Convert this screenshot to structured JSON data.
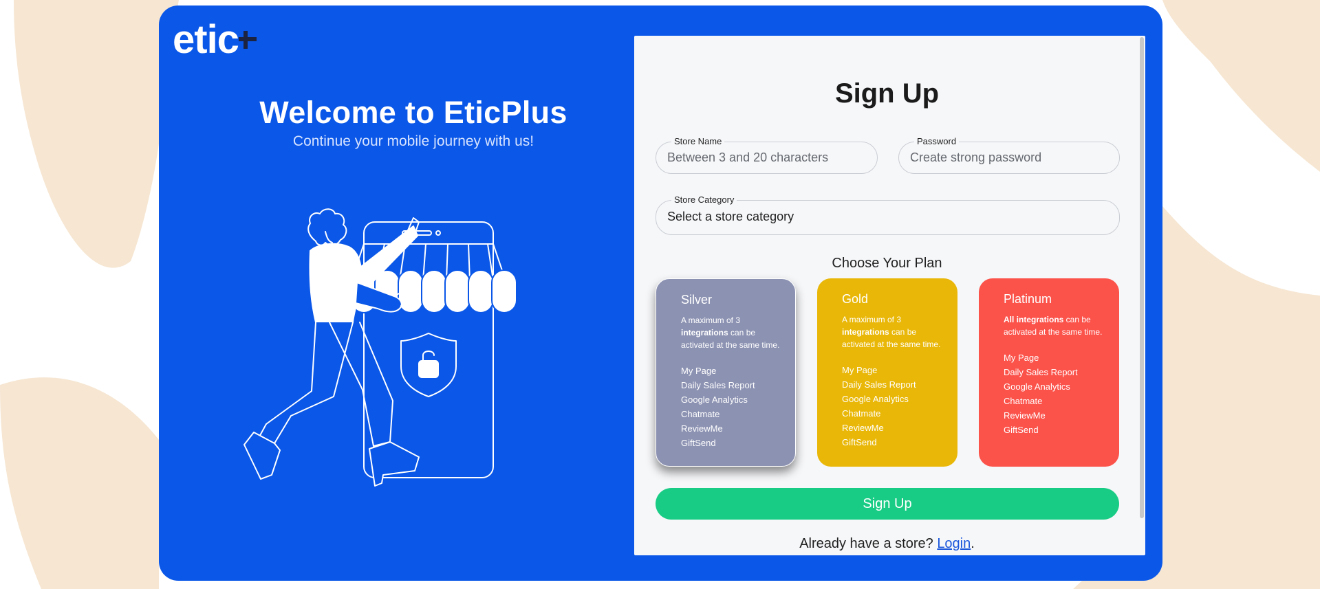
{
  "colors": {
    "background_blob": "#f6e6d2",
    "frame": "#0a57e8",
    "panel": "#f6f7f9",
    "signup_button": "#19cc85",
    "silver": "#8c92b2",
    "gold": "#e9b707",
    "platinum": "#fb524a",
    "link": "#1a56db"
  },
  "logo": {
    "text": "etic",
    "icon": "plus-icon"
  },
  "hero": {
    "title": "Welcome to EticPlus",
    "subtitle": "Continue your mobile journey with us!",
    "illustration": "person-pointing-at-phone-store-illustration"
  },
  "form": {
    "title": "Sign Up",
    "store_name": {
      "label": "Store Name",
      "placeholder": "Between 3 and 20 characters",
      "value": ""
    },
    "password": {
      "label": "Password",
      "placeholder": "Create strong password",
      "value": ""
    },
    "store_category": {
      "label": "Store Category",
      "selected": "Select a store category"
    },
    "plan_heading": "Choose Your Plan",
    "plans": [
      {
        "name": "Silver",
        "desc_prefix": "A maximum of 3 ",
        "desc_bold": "integrations",
        "desc_suffix": " can be activated at the same time.",
        "features": [
          "My Page",
          "Daily Sales Report",
          "Google Analytics",
          "Chatmate",
          "ReviewMe",
          "GiftSend"
        ],
        "selected": true
      },
      {
        "name": "Gold",
        "desc_prefix": "A maximum of 3 ",
        "desc_bold": "integrations",
        "desc_suffix": " can be activated at the same time.",
        "features": [
          "My Page",
          "Daily Sales Report",
          "Google Analytics",
          "Chatmate",
          "ReviewMe",
          "GiftSend"
        ],
        "selected": false
      },
      {
        "name": "Platinum",
        "desc_prefix": "",
        "desc_bold": "All integrations",
        "desc_suffix": " can be activated at the same time.",
        "features": [
          "My Page",
          "Daily Sales Report",
          "Google Analytics",
          "Chatmate",
          "ReviewMe",
          "GiftSend"
        ],
        "selected": false
      }
    ],
    "submit_label": "Sign Up",
    "login_prompt": "Already have a store? ",
    "login_link": "Login",
    "login_suffix": "."
  }
}
